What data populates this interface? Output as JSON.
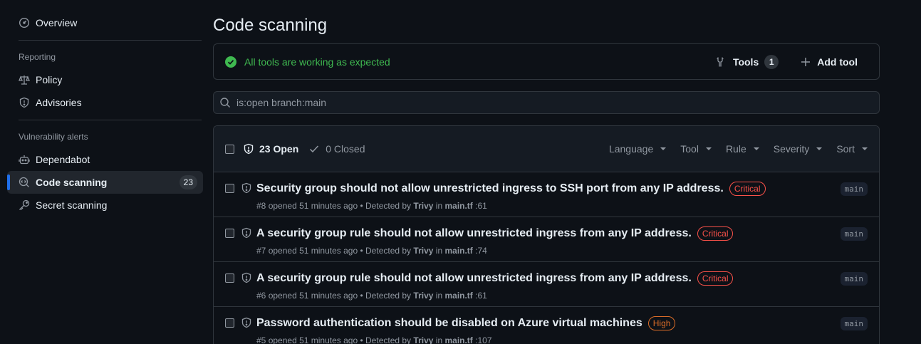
{
  "sidebar": {
    "overview": "Overview",
    "reporting_heading": "Reporting",
    "policy": "Policy",
    "advisories": "Advisories",
    "vuln_heading": "Vulnerability alerts",
    "dependabot": "Dependabot",
    "code_scanning": "Code scanning",
    "code_scanning_count": "23",
    "secret_scanning": "Secret scanning"
  },
  "main": {
    "title": "Code scanning",
    "status_text": "All tools are working as expected",
    "tools_label": "Tools",
    "tools_count": "1",
    "add_tool_label": "Add tool",
    "search_value": "is:open branch:main"
  },
  "list": {
    "open_label": "23 Open",
    "closed_label": "0 Closed",
    "filters": [
      "Language",
      "Tool",
      "Rule",
      "Severity",
      "Sort"
    ],
    "rows": [
      {
        "title": "Security group should not allow unrestricted ingress to SSH port from any IP address.",
        "severity": "Critical",
        "number": "#8",
        "opened": "opened 51 minutes ago",
        "detected_prefix": "• Detected by",
        "tool": "Trivy",
        "in": "in",
        "file": "main.tf",
        "line": ":61",
        "branch": "main"
      },
      {
        "title": "A security group rule should not allow unrestricted ingress from any IP address.",
        "severity": "Critical",
        "number": "#7",
        "opened": "opened 51 minutes ago",
        "detected_prefix": "• Detected by",
        "tool": "Trivy",
        "in": "in",
        "file": "main.tf",
        "line": ":74",
        "branch": "main"
      },
      {
        "title": "A security group rule should not allow unrestricted ingress from any IP address.",
        "severity": "Critical",
        "number": "#6",
        "opened": "opened 51 minutes ago",
        "detected_prefix": "• Detected by",
        "tool": "Trivy",
        "in": "in",
        "file": "main.tf",
        "line": ":61",
        "branch": "main"
      },
      {
        "title": "Password authentication should be disabled on Azure virtual machines",
        "severity": "High",
        "number": "#5",
        "opened": "opened 51 minutes ago",
        "detected_prefix": "• Detected by",
        "tool": "Trivy",
        "in": "in",
        "file": "main.tf",
        "line": ":107",
        "branch": "main"
      }
    ]
  },
  "colors": {
    "background": "#0d1117",
    "accent": "#1f6feb",
    "success": "#3fb950",
    "critical": "#f85149",
    "high": "#db6d28"
  }
}
